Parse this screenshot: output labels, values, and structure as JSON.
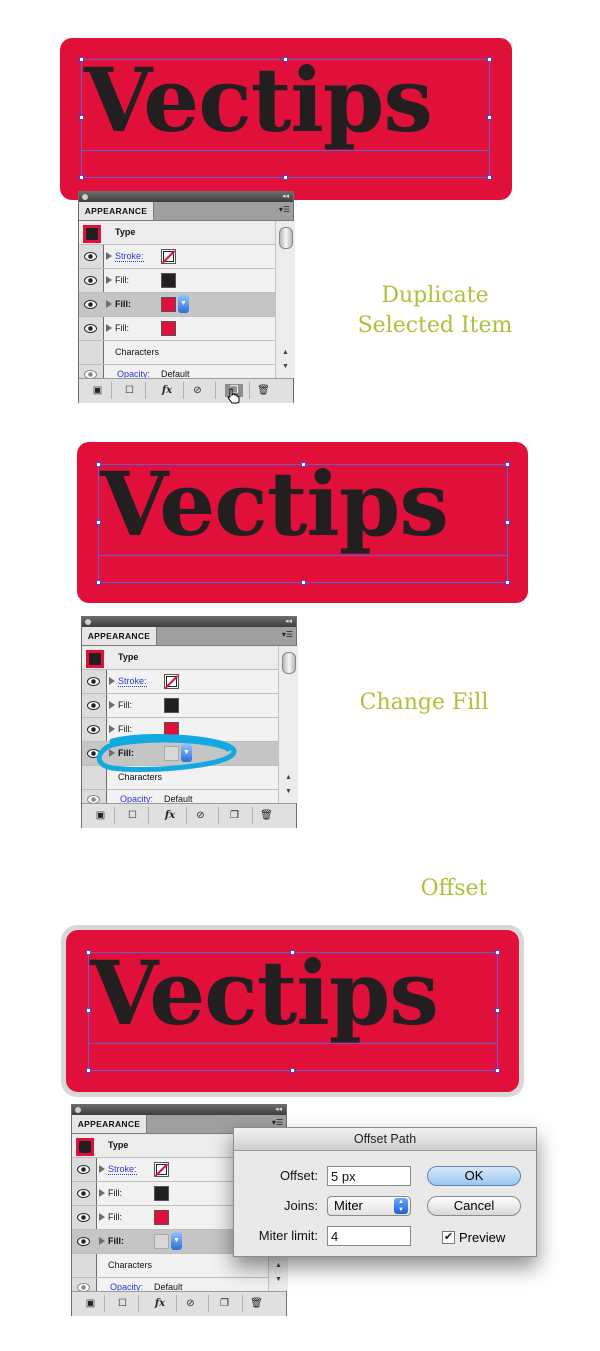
{
  "artwork": {
    "word": "Vectips"
  },
  "captions": {
    "step1_line1": "Duplicate",
    "step1_line2": "Selected Item",
    "step2": "Change Fill",
    "step3": "Offset"
  },
  "panel": {
    "tab": "APPEARANCE",
    "type_label": "Type",
    "stroke_label": "Stroke:",
    "fill_label": "Fill:",
    "characters_label": "Characters",
    "opacity_label": "Opacity:",
    "opacity_value": "Default"
  },
  "dialog": {
    "title": "Offset Path",
    "offset_label": "Offset:",
    "offset_value": "5 px",
    "joins_label": "Joins:",
    "joins_value": "Miter",
    "miter_label": "Miter limit:",
    "miter_value": "4",
    "ok": "OK",
    "cancel": "Cancel",
    "preview_label": "Preview"
  },
  "colors": {
    "red": "#e0103a",
    "dark": "#231f20",
    "caption": "#a7c43a"
  }
}
